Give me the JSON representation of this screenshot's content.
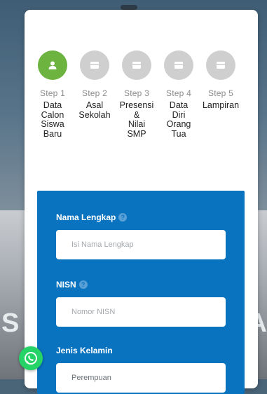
{
  "steps": [
    {
      "num": "Step 1",
      "label_lines": [
        "Data",
        "Calon",
        "Siswa",
        "Baru"
      ],
      "icon": "user-icon",
      "active": true
    },
    {
      "num": "Step 2",
      "label_lines": [
        "Asal",
        "Sekolah"
      ],
      "icon": "card-icon",
      "active": false
    },
    {
      "num": "Step 3",
      "label_lines": [
        "Presensi",
        "&",
        "Nilai",
        "SMP"
      ],
      "icon": "card-icon",
      "active": false
    },
    {
      "num": "Step 4",
      "label_lines": [
        "Data",
        "Diri",
        "Orang",
        "Tua"
      ],
      "icon": "card-icon",
      "active": false
    },
    {
      "num": "Step 5",
      "label_lines": [
        "Lampiran"
      ],
      "icon": "card-icon",
      "active": false
    }
  ],
  "form": {
    "nama_label": "Nama Lengkap",
    "nama_placeholder": "Isi Nama Lengkap",
    "nisn_label": "NISN",
    "nisn_placeholder": "Nomor NISN",
    "gender_label": "Jenis Kelamin",
    "gender_value": "Perempuan"
  },
  "colors": {
    "active_step": "#6cb33f",
    "inactive_step": "#cfcfcf",
    "form_panel": "#0a73c0",
    "whatsapp": "#25d366"
  },
  "floating": {
    "icon": "whatsapp-icon"
  }
}
